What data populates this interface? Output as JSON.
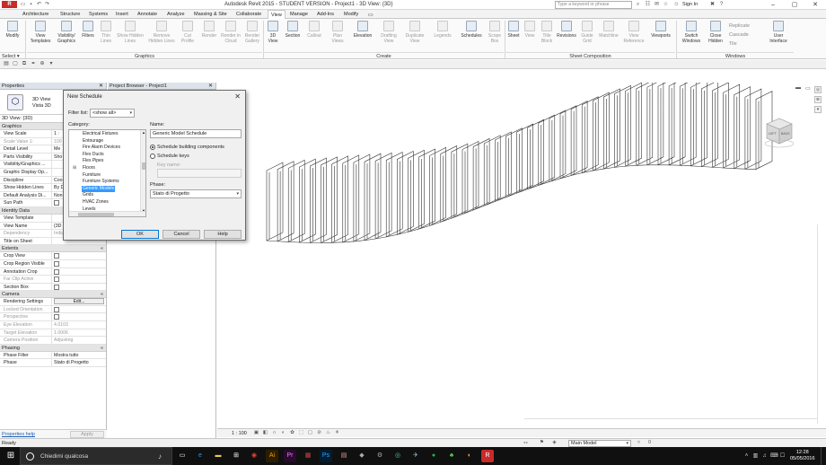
{
  "window": {
    "title": "Autodesk Revit 2015 - STUDENT VERSION -    Project1 - 3D View: {3D}",
    "search_placeholder": "Type a keyword or phrase",
    "sign_in": "Sign In",
    "min": "‒",
    "max": "▢",
    "close": "✕"
  },
  "tabs": [
    "Architecture",
    "Structure",
    "Systems",
    "Insert",
    "Annotate",
    "Analyze",
    "Massing & Site",
    "Collaborate",
    "View",
    "Manage",
    "Add-Ins",
    "Modify"
  ],
  "active_tab": "View",
  "ribbon": {
    "modify": "Modify",
    "select": "Select ▾",
    "graphics_label": "Graphics",
    "create_label": "Create",
    "sheet_label": "Sheet Composition",
    "windows_label": "Windows",
    "graphics": [
      "View Templates",
      "Visibility/ Graphics",
      "Filters",
      "Thin Lines",
      "Show Hidden Lines",
      "Remove Hidden Lines",
      "Cut Profile",
      "Render",
      "Render in Cloud",
      "Render Gallery"
    ],
    "create": [
      "3D View",
      "Section",
      "Callout",
      "Plan Views",
      "Elevation",
      "Drafting View",
      "Duplicate View",
      "Legends",
      "Schedules",
      "Scope Box"
    ],
    "sheet": [
      "Sheet",
      "View",
      "Title Block",
      "Revisions",
      "Guide Grid",
      "Matchline",
      "View Reference",
      "Viewports"
    ],
    "windows": [
      "Switch Windows",
      "Close Hidden",
      "Replicate",
      "Cascade",
      "Tile",
      "User Interface"
    ]
  },
  "properties": {
    "title": "Properties",
    "type_name": "3D View\nVista 3D",
    "instance": "3D View: {3D}",
    "help": "Properties help",
    "apply": "Apply",
    "graphics_cat": "Graphics",
    "identity_cat": "Identity Data",
    "extents_cat": "Extents",
    "camera_cat": "Camera",
    "phasing_cat": "Phasing",
    "graphics_rows": [
      {
        "k": "View Scale",
        "v": "1 :"
      },
      {
        "k": "Scale Value    1:",
        "v": "100"
      },
      {
        "k": "Detail Level",
        "v": "Me"
      },
      {
        "k": "Parts Visibility",
        "v": "Sho"
      },
      {
        "k": "Visibility/Graphics ...",
        "v": ""
      },
      {
        "k": "Graphic Display Op...",
        "v": ""
      },
      {
        "k": "Discipline",
        "v": "Coo"
      },
      {
        "k": "Show Hidden Lines",
        "v": "By D"
      },
      {
        "k": "Default Analysis Di...",
        "v": "Non"
      },
      {
        "k": "Sun Path",
        "v": ""
      }
    ],
    "identity_rows": [
      {
        "k": "View Template",
        "v": ""
      },
      {
        "k": "View Name",
        "v": "{3D"
      },
      {
        "k": "Dependency",
        "v": "Indipendente"
      },
      {
        "k": "Title on Sheet",
        "v": ""
      }
    ],
    "extents_rows": [
      {
        "k": "Crop View",
        "v": ""
      },
      {
        "k": "Crop Region Visible",
        "v": ""
      },
      {
        "k": "Annotation Crop",
        "v": ""
      },
      {
        "k": "Far Clip Active",
        "v": ""
      },
      {
        "k": "Section Box",
        "v": ""
      }
    ],
    "camera_rows": [
      {
        "k": "Rendering Settings",
        "v": "Edit..."
      },
      {
        "k": "Locked Orientation",
        "v": ""
      },
      {
        "k": "Perspective",
        "v": ""
      },
      {
        "k": "Eye Elevation",
        "v": "4.0103"
      },
      {
        "k": "Target Elevation",
        "v": "1.0006"
      },
      {
        "k": "Camera Position",
        "v": "Adjusting"
      }
    ],
    "phasing_rows": [
      {
        "k": "Phase Filter",
        "v": "Mostra tutto"
      },
      {
        "k": "Phase",
        "v": "Stato di Progetto"
      }
    ]
  },
  "browser": {
    "title": "Project Browser - Project1"
  },
  "dialog": {
    "title": "New Schedule",
    "filter_label": "Filter list:",
    "filter_value": "<show all>",
    "category_label": "Category:",
    "categories": [
      "Electrical Fixtures",
      "Entourage",
      "Fire Alarm Devices",
      "Flex Ducts",
      "Flex Pipes",
      "Floors",
      "Furniture",
      "Furniture Systems",
      "Generic Models",
      "Grids",
      "HVAC Zones",
      "Levels"
    ],
    "selected_category": "Generic Models",
    "name_label": "Name:",
    "name_value": "Generic Model Schedule",
    "radio1": "Schedule building components",
    "radio2": "Schedule keys",
    "key_name_label": "Key name:",
    "phase_label": "Phase:",
    "phase_value": "Stato di Progetto",
    "ok": "OK",
    "cancel": "Cancel",
    "help": "Help"
  },
  "view_control": {
    "scale": "1 : 100"
  },
  "status": {
    "text": "Ready",
    "model": "Main Model"
  },
  "taskbar": {
    "search": "Chiedimi qualcosa",
    "time": "12:28",
    "date": "05/05/2016"
  },
  "viewcube": {
    "left": "LEFT",
    "back": "BACK"
  },
  "colors": {
    "accent_red": "#c92a2a",
    "selection": "#3399ff",
    "taskbar": "#101010"
  }
}
